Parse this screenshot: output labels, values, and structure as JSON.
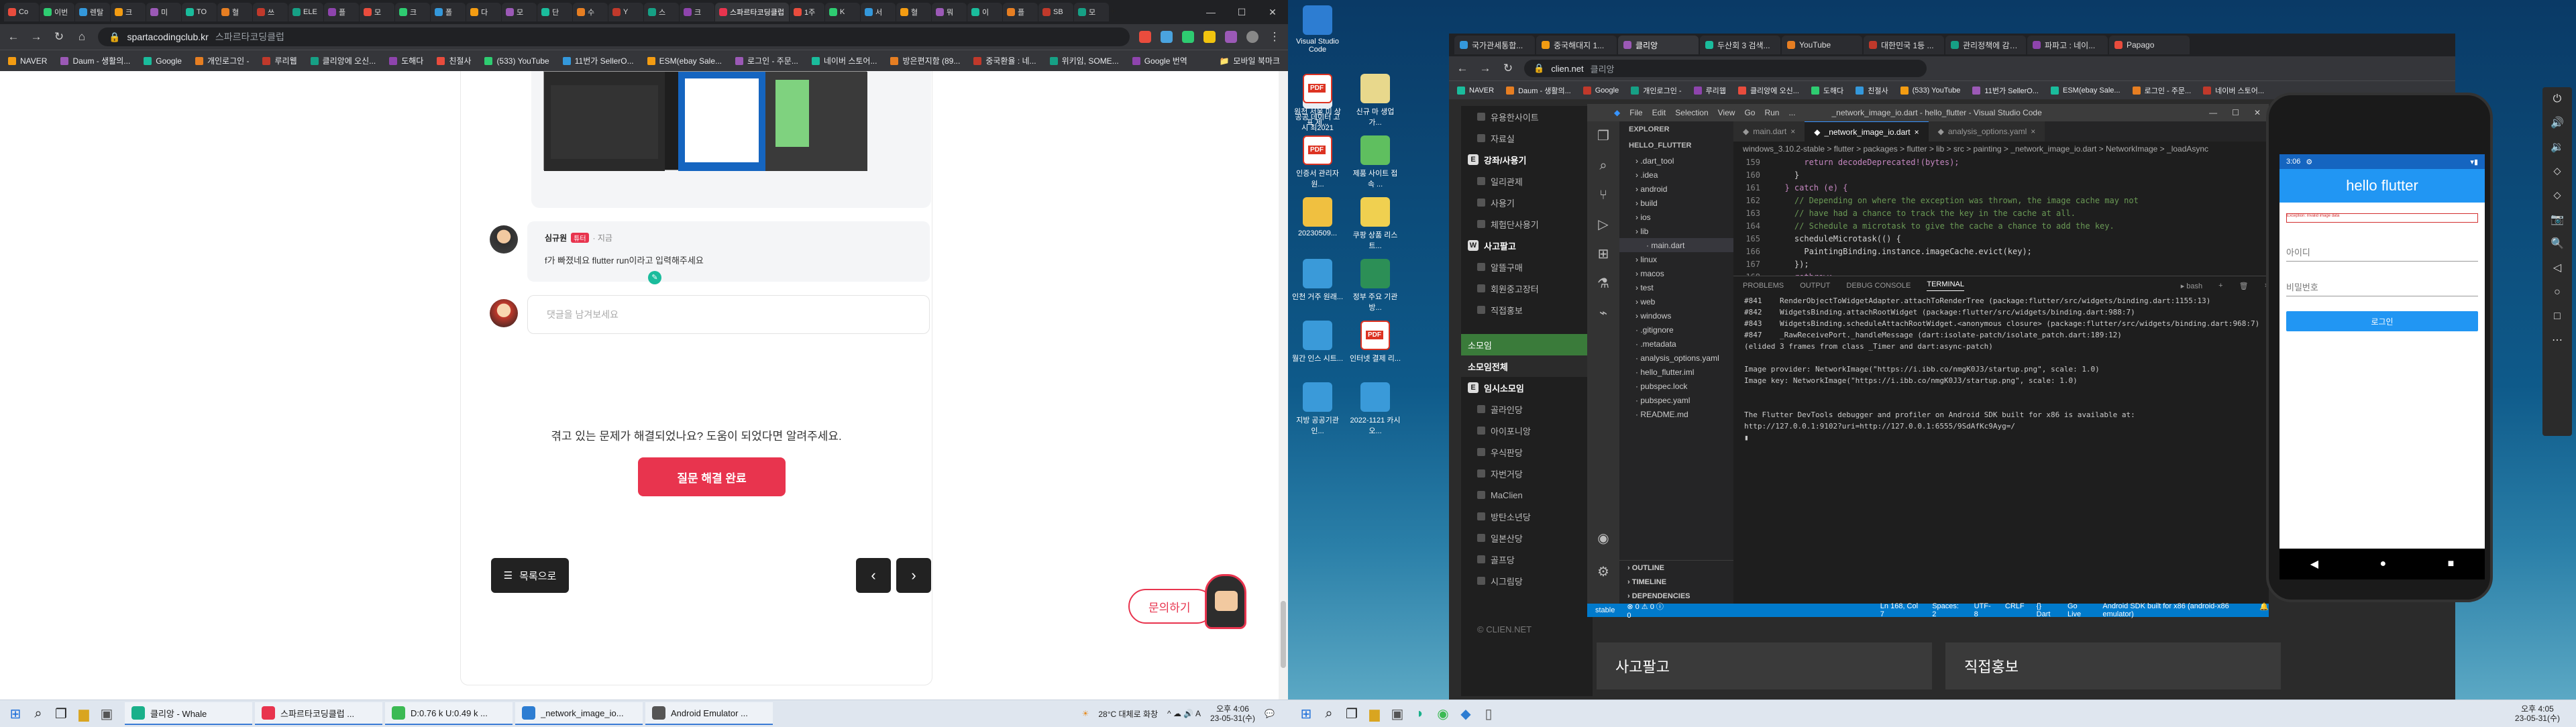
{
  "left_browser": {
    "tabs": [
      "Co",
      "이번",
      "렌탈",
      "크",
      "미",
      "TO",
      "혈",
      "쓰",
      "ELE",
      "플",
      "모",
      "크",
      "폴",
      "다",
      "모",
      "단",
      "수",
      "Y",
      "스",
      "크",
      "1주",
      "K",
      "서",
      "혈",
      "뭐",
      "이",
      "플",
      "SB",
      "모"
    ],
    "active_tab": "스파르타코딩클럽",
    "url": "spartacodingclub.kr",
    "url_placeholder": "스파르타코딩클럽",
    "bookmarks": [
      "NAVER",
      "Daum - 생활의...",
      "Google",
      "개인로그인 -",
      "루리웹",
      "클리앙에 오신...",
      "도해다",
      "친절사",
      "(533) YouTube",
      "11번가 SellerO...",
      "ESM(ebay Sale...",
      "로그인 - 주문...",
      "네이버 스토어...",
      "방은편지함 (89...",
      "중국환율 : 네...",
      "위키임, SOME...",
      "Google 번역"
    ],
    "bookmark_folder": "모바일 북마크",
    "comment": {
      "author": "심규원",
      "badge": "튜터",
      "time": "· 지금",
      "text": "f가 빠졌네요 flutter run이라고 입력해주세요"
    },
    "comment_input_placeholder": "댓글을 남겨보세요",
    "solved_question": "겪고 있는 문제가 해결되었나요? 도움이 되었다면 알려주세요.",
    "solved_button": "질문 해결 완료",
    "list_button": "목록으로",
    "prev": "‹",
    "next": "›",
    "inquiry_button": "문의하기"
  },
  "left_taskbar": {
    "apps": [
      "클리앙 - Whale",
      "스파르타코딩클럽 ...",
      "D:0.76 k U:0.49 k ...",
      "_network_image_io...",
      "Android Emulator ..."
    ],
    "weather": "28°C 대체로 화창",
    "tray": "^ ☁ 🔊 A",
    "time": "오후 4:06",
    "date": "23-05-31(수)"
  },
  "desktop_icons": [
    {
      "label": "Visual Studio Code",
      "color": "#2d7dd2"
    },
    {
      "label": "공공 데이터 고시 최2021",
      "color": "#e9eef4"
    },
    {
      "label": "원천 서울 미 상표 제...",
      "color": "pdf"
    },
    {
      "label": "신규 마 생업 가...",
      "color": "#e8d88c"
    },
    {
      "label": "인증서 관리자 원...",
      "color": "pdf"
    },
    {
      "label": "제품 사이트 접속 ...",
      "color": "#5fbf5f"
    },
    {
      "label": "20230509...",
      "color": "#f0c040"
    },
    {
      "label": "쿠팡 상품 리스트...",
      "color": "#f0d050"
    },
    {
      "label": "인천 거주 원래...",
      "color": "#3a9ad9"
    },
    {
      "label": "정부 주요 기관 방...",
      "color": "#2c8f56"
    },
    {
      "label": "월간 인스 시트...",
      "color": "#3a9ad9"
    },
    {
      "label": "인터넷 결제 리...",
      "color": "pdf"
    },
    {
      "label": "지방 공공기관 인...",
      "color": "#3a9ad9"
    },
    {
      "label": "2022-1121 카시오...",
      "color": "#3a9ad9"
    }
  ],
  "right_browser": {
    "tabs": [
      "국가관세통합...",
      "중국해대지 1...",
      "클리앙",
      "두산회 3 검색...",
      "YouTube",
      "대한민국 1등 ...",
      "관리정책에 감사...",
      "파파고 : 네이...",
      "Papago"
    ],
    "active_tab": "클리앙",
    "url": "clien.net",
    "url_placeholder": "클리앙",
    "bookmarks": [
      "NAVER",
      "Daum - 생활의...",
      "Google",
      "개인로그인 -",
      "루리웹",
      "클리앙에 오신...",
      "도해다",
      "친절사",
      "(533) YouTube",
      "11번가 SellerO...",
      "ESM(ebay Sale...",
      "로그인 - 주문...",
      "네이버 스토어..."
    ],
    "nav": [
      "유용한사이트",
      "자료실"
    ],
    "nav_header1": "강좌/사용기",
    "nav_items1": [
      "일리관제",
      "사용기",
      "체험단사용기"
    ],
    "nav_header2": "사고팔고",
    "nav_items2": [
      "알뜰구매",
      "회원중고장터",
      "직접홍보"
    ],
    "nav_green": "소모임",
    "nav_dark": "소모임전체",
    "nav_header3": "임시소모임",
    "nav_items3": [
      "골라인당",
      "아이포니앙",
      "우식판당",
      "자번거당",
      "MaClien",
      "방탄소년당",
      "일본산당",
      "골프당",
      "시그림당"
    ],
    "ad_left": "사고팔고",
    "ad_right": "직접홍보",
    "footer": "© CLIEN.NET"
  },
  "vscode": {
    "title": "_network_image_io.dart - hello_flutter - Visual Studio Code",
    "menus": [
      "File",
      "Edit",
      "Selection",
      "View",
      "Go",
      "Run",
      "..."
    ],
    "explorer_header": "EXPLORER",
    "project": "HELLO_FLUTTER",
    "files": [
      ".dart_tool",
      ".idea",
      "android",
      "build",
      "ios",
      "lib",
      "main.dart",
      "linux",
      "macos",
      "test",
      "web",
      "windows",
      ".gitignore",
      ".metadata",
      "analysis_options.yaml",
      "hello_flutter.iml",
      "pubspec.lock",
      "pubspec.yaml",
      "README.md"
    ],
    "selected_file": "main.dart",
    "tabs": [
      "main.dart",
      "_network_image_io.dart",
      "analysis_options.yaml"
    ],
    "active_tab": "_network_image_io.dart",
    "breadcrumb": "windows_3.10.2-stable > flutter > packages > flutter > lib > src > painting > _network_image_io.dart > NetworkImage > _loadAsync",
    "code": [
      {
        "n": "159",
        "t": "      return decodeDeprecated!(bytes);"
      },
      {
        "n": "160",
        "t": "    }"
      },
      {
        "n": "161",
        "t": "  } catch (e) {"
      },
      {
        "n": "162",
        "t": "    // Depending on where the exception was thrown, the image cache may not"
      },
      {
        "n": "163",
        "t": "    // have had a chance to track the key in the cache at all."
      },
      {
        "n": "164",
        "t": "    // Schedule a microtask to give the cache a chance to add the key."
      },
      {
        "n": "165",
        "t": "    scheduleMicrotask(() {"
      },
      {
        "n": "166",
        "t": "      PaintingBinding.instance.imageCache.evict(key);"
      },
      {
        "n": "167",
        "t": "    });"
      },
      {
        "n": "168",
        "t": "    rethrow;"
      }
    ],
    "panel_tabs": [
      "PROBLEMS",
      "OUTPUT",
      "DEBUG CONSOLE",
      "TERMINAL"
    ],
    "active_panel": "TERMINAL",
    "terminal_shell": "bash",
    "terminal": [
      "#841    RenderObjectToWidgetAdapter.attachToRenderTree (package:flutter/src/widgets/binding.dart:1155:13)",
      "#842    WidgetsBinding.attachRootWidget (package:flutter/src/widgets/binding.dart:988:7)",
      "#843    WidgetsBinding.scheduleAttachRootWidget.<anonymous closure> (package:flutter/src/widgets/binding.dart:968:7)",
      "#847    _RawReceivePort._handleMessage (dart:isolate-patch/isolate_patch.dart:189:12)",
      "(elided 3 frames from class _Timer and dart:async-patch)",
      "",
      "Image provider: NetworkImage(\"https://i.ibb.co/nmgK0J3/startup.png\", scale: 1.0)",
      "Image key: NetworkImage(\"https://i.ibb.co/nmgK0J3/startup.png\", scale: 1.0)",
      "",
      "",
      "The Flutter DevTools debugger and profiler on Android SDK built for x86 is available at:",
      "http://127.0.0.1:9102?uri=http://127.0.0.1:6555/9SdAfKc9Ayg=/"
    ],
    "outline": [
      "OUTLINE",
      "TIMELINE",
      "DEPENDENCIES"
    ],
    "status_left": "⊗ 0 ⚠ 0  ⓘ 0",
    "branch": "stable",
    "status_right": [
      "Ln 168, Col 7",
      "Spaces: 2",
      "UTF-8",
      "CRLF",
      "{} Dart",
      "Go Live",
      "Android SDK built for x86 (android-x86 emulator)"
    ]
  },
  "emulator": {
    "status_time": "3:06",
    "app_title": "hello flutter",
    "error_text": "Exception: Invalid image data",
    "id_label": "아이디",
    "password_label": "비밀번호",
    "login_button": "로그인",
    "nav": [
      "◀",
      "●",
      "■"
    ],
    "toolbar": [
      "⏻",
      "🔊",
      "🔉",
      "⬦",
      "⬦",
      "📷",
      "🔍",
      "◁",
      "○",
      "□",
      "⋯"
    ]
  },
  "right_taskbar": {
    "time": "오후 4:05",
    "date": "23-05-31(수)"
  }
}
